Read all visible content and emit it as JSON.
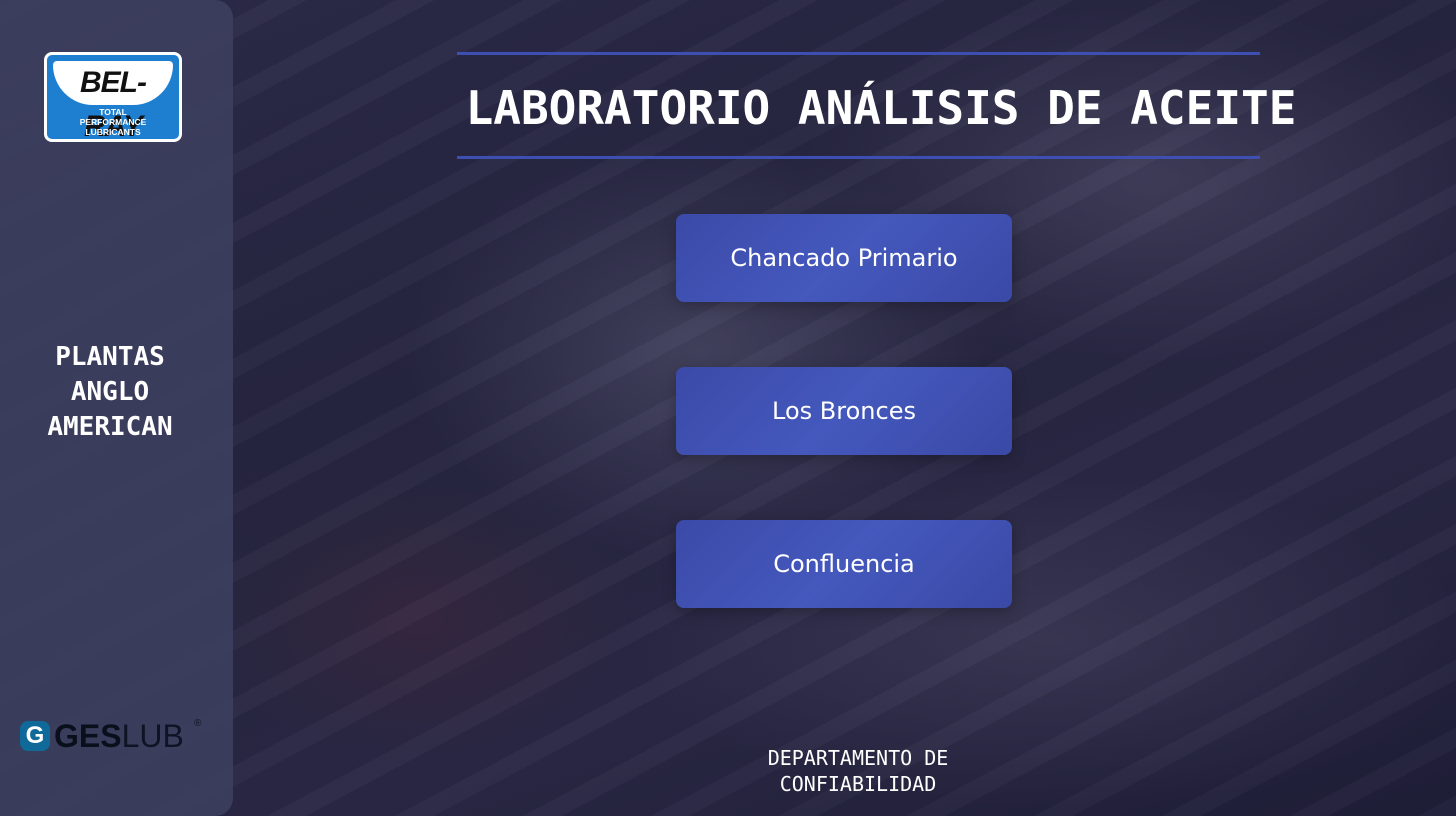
{
  "sidebar": {
    "logo": {
      "brand": "BEL-RAY",
      "tagline_lines": [
        "TOTAL",
        "PERFORMANCE",
        "LUBRICANTS"
      ]
    },
    "plants_lines": [
      "PLANTAS",
      "ANGLO",
      "AMERICAN"
    ],
    "footer_logo": {
      "mark": "G",
      "text_bold": "GES",
      "text_light": "LUB",
      "registered": "®"
    }
  },
  "main": {
    "title": "LABORATORIO ANÁLISIS DE ACEITE",
    "buttons": [
      {
        "label": "Chancado Primario"
      },
      {
        "label": "Los Bronces"
      },
      {
        "label": "Confluencia"
      }
    ],
    "footer_lines": [
      "DEPARTAMENTO DE",
      "CONFIABILIDAD"
    ]
  },
  "colors": {
    "accent": "#3d4fb0",
    "button": "#4458bd",
    "sidebar": "#3e4060",
    "background": "#23223f",
    "logo_blue": "#1e7fd0"
  }
}
